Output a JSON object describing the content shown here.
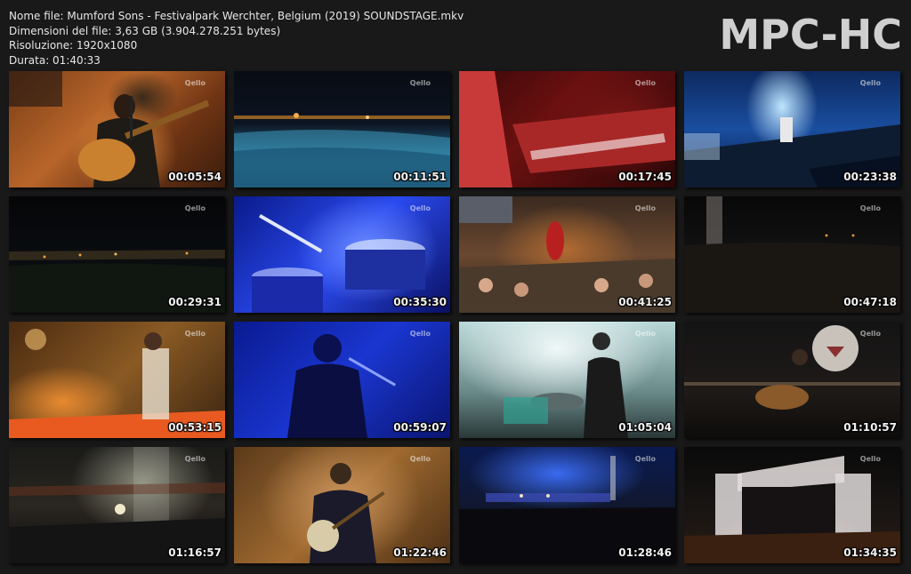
{
  "info": {
    "filename": "Nome file: Mumford Sons - Festivalpark Werchter, Belgium (2019) SOUNDSTAGE.mkv",
    "filesize": "Dimensioni del file: 3,63 GB (3.904.278.251 bytes)",
    "resolution": "Risoluzione: 1920x1080",
    "duration": "Durata: 01:40:33"
  },
  "logo": "MPC-HC",
  "watermark": "Qello",
  "thumbnails": [
    {
      "time": "00:05:54",
      "scene": "acoustic-guitarist-orange"
    },
    {
      "time": "00:11:51",
      "scene": "crowd-night-stage"
    },
    {
      "time": "00:17:45",
      "scene": "keyboard-red"
    },
    {
      "time": "00:23:38",
      "scene": "stage-blue-lights"
    },
    {
      "time": "00:29:31",
      "scene": "dark-crowd-lights"
    },
    {
      "time": "00:35:30",
      "scene": "drums-blue"
    },
    {
      "time": "00:41:25",
      "scene": "stage-crowd-doublebass"
    },
    {
      "time": "00:47:18",
      "scene": "dark-night-crowd"
    },
    {
      "time": "00:53:15",
      "scene": "band-orange-stage"
    },
    {
      "time": "00:59:07",
      "scene": "cellist-blue"
    },
    {
      "time": "01:05:04",
      "scene": "drummer-bright"
    },
    {
      "time": "01:10:57",
      "scene": "guitarist-dark-stage"
    },
    {
      "time": "01:16:57",
      "scene": "stage-smoke-lights"
    },
    {
      "time": "01:22:46",
      "scene": "banjo-player"
    },
    {
      "time": "01:28:46",
      "scene": "wide-blue-stage"
    },
    {
      "time": "01:34:35",
      "scene": "stage-screens-night"
    }
  ]
}
